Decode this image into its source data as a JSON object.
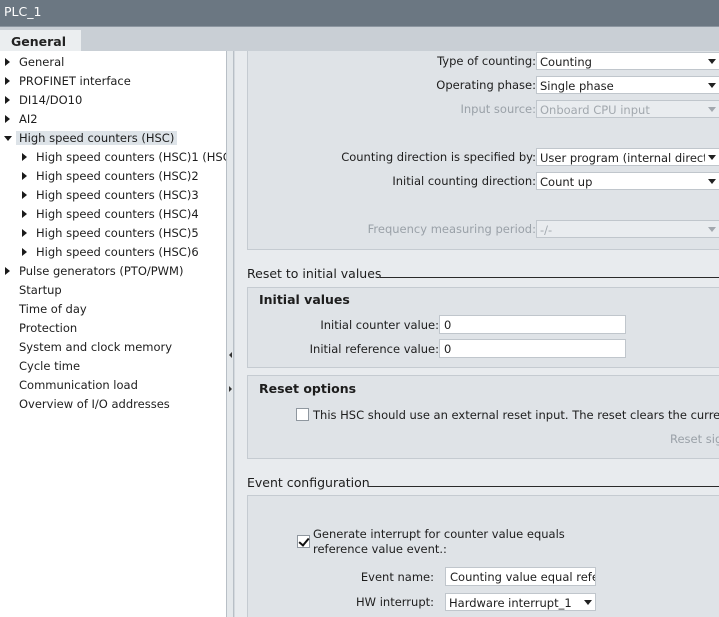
{
  "window": {
    "title": "PLC_1"
  },
  "tabs": {
    "general": "General"
  },
  "nav": {
    "items": [
      {
        "label": "General",
        "arrow": "right",
        "indent": 0
      },
      {
        "label": "PROFINET interface",
        "arrow": "right",
        "indent": 0
      },
      {
        "label": "DI14/DO10",
        "arrow": "right",
        "indent": 0
      },
      {
        "label": "AI2",
        "arrow": "right",
        "indent": 0
      },
      {
        "label": "High speed counters (HSC)",
        "arrow": "down",
        "indent": 0,
        "selected": true
      },
      {
        "label": "High speed counters (HSC)1 (HSC...",
        "arrow": "right",
        "indent": 1
      },
      {
        "label": "High speed counters (HSC)2",
        "arrow": "right",
        "indent": 1
      },
      {
        "label": "High speed counters (HSC)3",
        "arrow": "right",
        "indent": 1
      },
      {
        "label": "High speed counters (HSC)4",
        "arrow": "right",
        "indent": 1
      },
      {
        "label": "High speed counters (HSC)5",
        "arrow": "right",
        "indent": 1
      },
      {
        "label": "High speed counters (HSC)6",
        "arrow": "right",
        "indent": 1
      },
      {
        "label": "Pulse generators (PTO/PWM)",
        "arrow": "right",
        "indent": 0
      },
      {
        "label": "Startup",
        "arrow": "none",
        "indent": 0
      },
      {
        "label": "Time of day",
        "arrow": "none",
        "indent": 0
      },
      {
        "label": "Protection",
        "arrow": "none",
        "indent": 0
      },
      {
        "label": "System and clock memory",
        "arrow": "none",
        "indent": 0
      },
      {
        "label": "Cycle time",
        "arrow": "none",
        "indent": 0
      },
      {
        "label": "Communication load",
        "arrow": "none",
        "indent": 0
      },
      {
        "label": "Overview of I/O addresses",
        "arrow": "none",
        "indent": 0
      }
    ]
  },
  "counter_function": {
    "type_of_counting": {
      "label": "Type of counting:",
      "value": "Counting"
    },
    "operating_phase": {
      "label": "Operating phase:",
      "value": "Single phase"
    },
    "input_source": {
      "label": "Input source:",
      "value": "Onboard CPU input"
    },
    "direction_specified_by": {
      "label": "Counting direction is specified by:",
      "value": "User program (internal directio"
    },
    "initial_direction": {
      "label": "Initial counting direction:",
      "value": "Count up"
    },
    "freq_period": {
      "label": "Frequency measuring period:",
      "value": "-/-"
    }
  },
  "reset_section": {
    "title": "Reset to initial values",
    "initial_values": {
      "title": "Initial values",
      "counter_label": "Initial counter value:",
      "counter_value": "0",
      "reference_label": "Initial reference value:",
      "reference_value": "0"
    },
    "reset_options": {
      "title": "Reset options",
      "external_reset_label": "This HSC should use an external reset input.  The reset clears the current va",
      "external_reset_checked": false,
      "reset_signal_label": "Reset sig"
    }
  },
  "event_section": {
    "title": "Event configuration",
    "interrupt_label_line1": "Generate interrupt for counter value equals",
    "interrupt_label_line2": "reference value event.:",
    "interrupt_checked": true,
    "event_name_label": "Event name:",
    "event_name_value": "Counting value equal refer",
    "hw_interrupt_label": "HW interrupt:",
    "hw_interrupt_value": "Hardware interrupt_1"
  },
  "icons": {
    "expand": "triangle-right-icon",
    "collapse": "triangle-down-icon",
    "dropdown": "chevron-down-icon",
    "check": "checkmark-icon"
  }
}
